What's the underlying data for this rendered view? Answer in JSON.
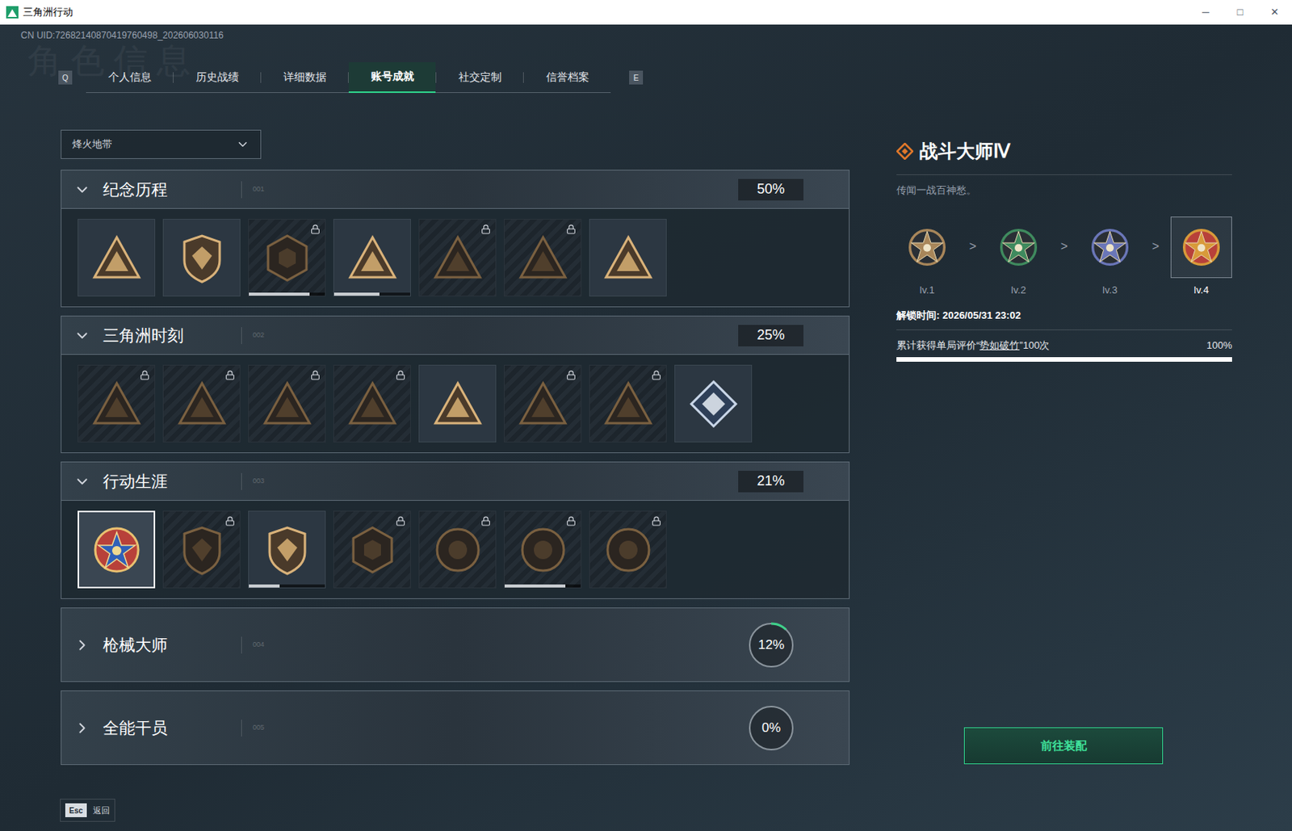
{
  "window": {
    "title": "三角洲行动",
    "controls": [
      "─",
      "□",
      "✕"
    ]
  },
  "uid": "CN UID:72682140870419760498_202606030116",
  "watermark": "角色信息",
  "tabs": {
    "prev_key": "Q",
    "next_key": "E",
    "items": [
      {
        "label": "个人信息",
        "selected": false
      },
      {
        "label": "历史战绩",
        "selected": false
      },
      {
        "label": "详细数据",
        "selected": false
      },
      {
        "label": "账号成就",
        "selected": true
      },
      {
        "label": "社交定制",
        "selected": false
      },
      {
        "label": "信誉档案",
        "selected": false
      }
    ]
  },
  "mode_select": {
    "value": "烽火地带"
  },
  "sections": [
    {
      "number": "001",
      "title": "纪念历程",
      "percent": "50%",
      "expanded": true,
      "badges": [
        {
          "locked": false,
          "selected": false
        },
        {
          "locked": false,
          "selected": false
        },
        {
          "locked": true,
          "selected": false,
          "level": 0.8
        },
        {
          "locked": false,
          "selected": false,
          "level": 0.6
        },
        {
          "locked": true,
          "selected": false
        },
        {
          "locked": true,
          "selected": false
        },
        {
          "locked": false,
          "selected": false
        }
      ]
    },
    {
      "number": "002",
      "title": "三角洲时刻",
      "percent": "25%",
      "expanded": true,
      "badges": [
        {
          "locked": true,
          "selected": false
        },
        {
          "locked": true,
          "selected": false
        },
        {
          "locked": true,
          "selected": false
        },
        {
          "locked": true,
          "selected": false
        },
        {
          "locked": false,
          "selected": false
        },
        {
          "locked": true,
          "selected": false
        },
        {
          "locked": true,
          "selected": false
        },
        {
          "locked": false,
          "selected": false
        }
      ]
    },
    {
      "number": "003",
      "title": "行动生涯",
      "percent": "21%",
      "expanded": true,
      "badges": [
        {
          "locked": false,
          "selected": true
        },
        {
          "locked": true,
          "selected": false
        },
        {
          "locked": false,
          "selected": false,
          "level": 0.4
        },
        {
          "locked": true,
          "selected": false
        },
        {
          "locked": true,
          "selected": false
        },
        {
          "locked": true,
          "selected": false,
          "level": 0.8
        },
        {
          "locked": true,
          "selected": false
        }
      ]
    },
    {
      "number": "004",
      "title": "枪械大师",
      "percent": "12%",
      "expanded": false,
      "level": 0.12,
      "badges": []
    },
    {
      "number": "005",
      "title": "全能干员",
      "percent": "0%",
      "expanded": false,
      "level": 0,
      "badges": []
    }
  ],
  "detail": {
    "title": "战斗大师Ⅳ",
    "subtitle": "传闻一战百神愁。",
    "separator": ">",
    "levels": [
      {
        "label": "lv.1",
        "selected": false,
        "color": "#a8865a"
      },
      {
        "label": "lv.2",
        "selected": false,
        "color": "#3f8a5e"
      },
      {
        "label": "lv.3",
        "selected": false,
        "color": "#6a76b8"
      },
      {
        "label": "lv.4",
        "selected": true,
        "color": "#d89a3a"
      }
    ],
    "unlock_time": "解锁时间: 2026/05/31 23:02",
    "requirement": {
      "prefix": "累计获得单局评价“",
      "highlight": "势如破竹",
      "suffix": "”100次",
      "reading": "100%",
      "level": 1
    },
    "button": "前往装配"
  },
  "footer": {
    "key": "Esc",
    "label": "返回"
  }
}
